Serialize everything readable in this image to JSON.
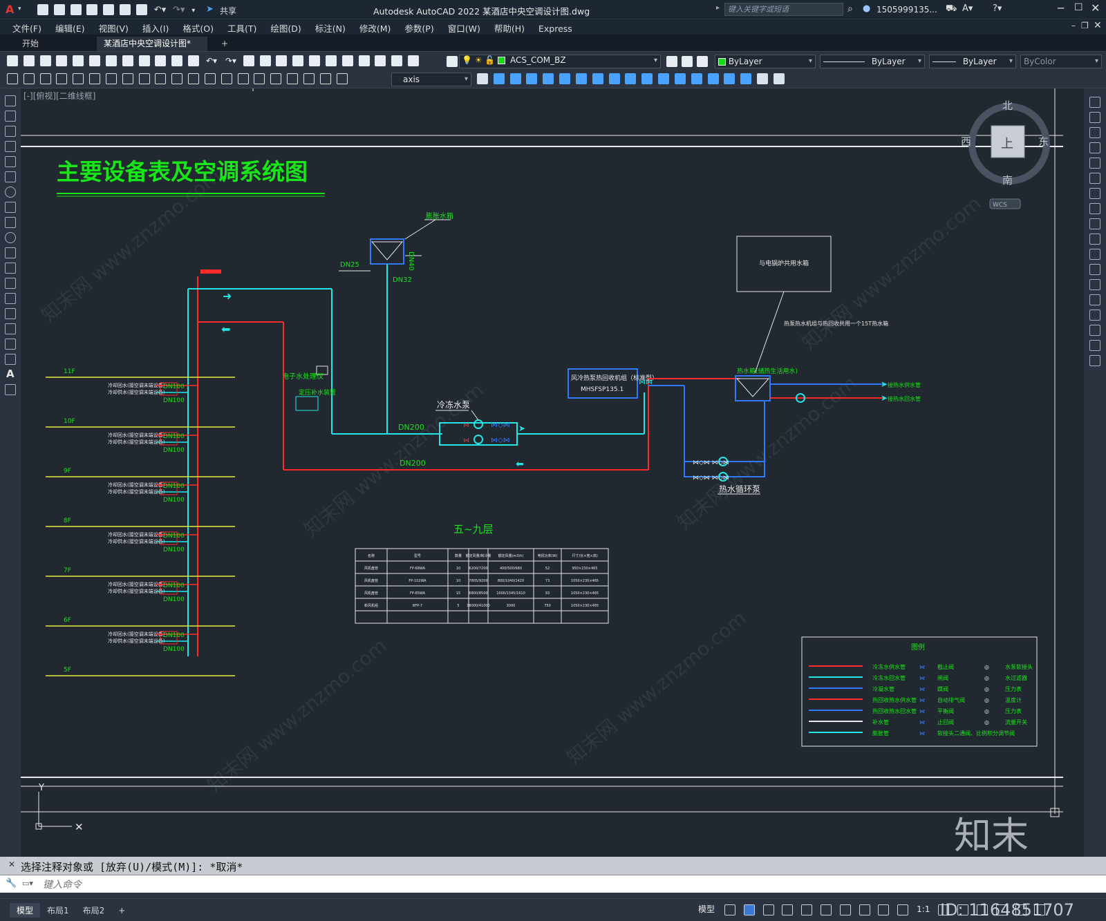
{
  "app": {
    "title": "Autodesk AutoCAD 2022    某酒店中央空调设计图.dwg",
    "logo": "A",
    "share_label": "共享",
    "search_placeholder": "键入关键字或短语",
    "user": "1505999135...",
    "window_controls": [
      "minimize-icon",
      "maximize-icon",
      "close-icon"
    ]
  },
  "menu": [
    "文件(F)",
    "编辑(E)",
    "视图(V)",
    "插入(I)",
    "格式(O)",
    "工具(T)",
    "绘图(D)",
    "标注(N)",
    "修改(M)",
    "参数(P)",
    "窗口(W)",
    "帮助(H)",
    "Express"
  ],
  "tabs": {
    "start": "开始",
    "doc": "某酒店中央空调设计图*",
    "add": "+"
  },
  "toolbar": {
    "layer": "ACS_COM_BZ",
    "color": "ByLayer",
    "linetype": "ByLayer",
    "lineweight": "ByLayer",
    "plotstyle": "ByColor",
    "dimstyle": "axis"
  },
  "viewport_label": "[-][俯视][二维线框]",
  "viewcube": {
    "north": "北",
    "south": "南",
    "west": "西",
    "east": "东",
    "top": "上",
    "wcs": "WCS"
  },
  "drawing": {
    "title": "主要设备表及空调系统图",
    "floors": [
      "11F",
      "10F",
      "9F",
      "8F",
      "7F",
      "6F",
      "5F"
    ],
    "riser_dn": "DN100",
    "riser_labels": [
      "冷却回水(接空调末端设备)",
      "冷却供水(接空调末端设备)"
    ],
    "tank_label": "膨胀水箱",
    "dn25": "DN25",
    "dn32": "DN32",
    "dn40": "DN40",
    "water_treatment": "电子水处理仪",
    "pressure_device": "定压补水装置",
    "chilled_pump": "冷冻水泵",
    "dn200a": "DN200",
    "dn200b": "DN200",
    "chiller_name": "风冷热泵热回收机组（标准型）",
    "chiller_model": "MHSFSP135.1",
    "boiler_box": "与电锅炉共用水箱",
    "boiler_note": "热泵热水机组与热回收共用一个15T热水箱",
    "hot_tank_label": "热水箱(储热生活用水)",
    "hot_pump": "热水循环泵",
    "hot_out1": "接热水供水管",
    "hot_out2": "接热水回水管",
    "table_title": "五~九层",
    "table_header": [
      "名称",
      "型号",
      "数量",
      "额定风量/制冷量",
      "额定风量(m3/h)",
      "电机功率(W)",
      "尺寸(长×宽×高)"
    ],
    "table_rows": [
      [
        "风机盘管",
        "FP-68WA",
        "10",
        "6200/7200",
        "400/500/680",
        "52",
        "950×230×465"
      ],
      [
        "风机盘管",
        "FP-102WA",
        "10",
        "7805/9200",
        "800/1040/1420",
        "73",
        "1050×230×465"
      ],
      [
        "风机盘管",
        "FP-85WA",
        "15",
        "6800/8500",
        "1000/1345/1610",
        "93",
        "1050×230×465"
      ],
      [
        "新风机组",
        "BFP-7",
        "5",
        "18000/41000",
        "3000",
        "750",
        "1050×230×465"
      ],
      [
        "",
        "",
        "",
        "",
        "",
        "",
        ""
      ]
    ],
    "legend_title": "图例",
    "legend_lines": [
      "冷冻水供水管",
      "冷冻水回水管",
      "冷凝水管",
      "热回收热水供水管",
      "热回收热水回水管",
      "补水管",
      "膨胀管"
    ],
    "legend_mid": [
      "截止阀",
      "闸阀",
      "蝶阀",
      "自动排气阀",
      "平衡阀",
      "止回阀",
      "软接头二通阀、比例积分调节阀"
    ],
    "legend_right": [
      "水泵软接头",
      "水过滤器",
      "压力表",
      "温度计",
      "压力表",
      "流量开关"
    ],
    "watermark": "知末网 www.znzmo.com",
    "brand": "知末",
    "id_text": "ID: 1164851707"
  },
  "command": {
    "history": "选择注释对象或 [放弃(U)/模式(M)]: *取消*",
    "placeholder": "键入命令"
  },
  "layout_tabs": [
    "模型",
    "布局1",
    "布局2",
    "+"
  ],
  "status": {
    "model": "模型",
    "scale": "1:1"
  },
  "colors": {
    "red": "#ff2a2a",
    "cyan": "#22e6e6",
    "blue": "#2f7bff",
    "green": "#19e619",
    "yellow": "#e8e83a",
    "white": "#e8e8e8",
    "bg": "#212830"
  }
}
